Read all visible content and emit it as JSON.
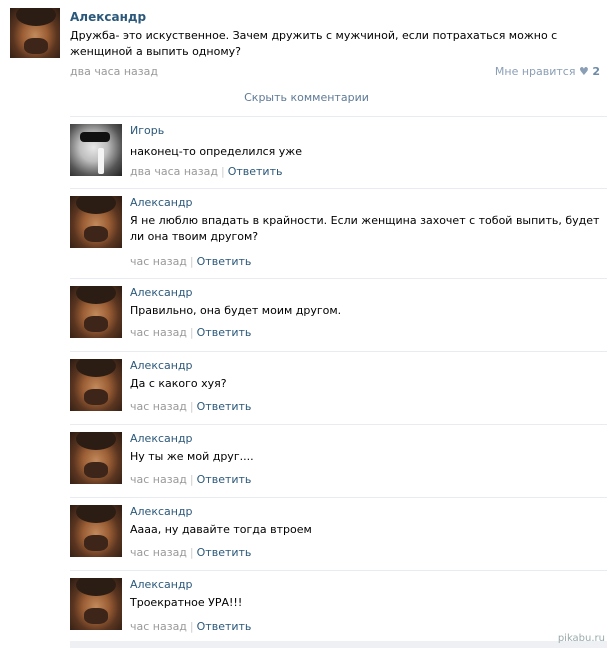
{
  "post": {
    "author": "Александр",
    "text": "Дружба- это искуственное. Зачем дружить с мужчиной, если потрахаться можно с женщиной а выпить одному?",
    "time": "два часа назад",
    "like_label": "Мне нравится",
    "like_count": "2"
  },
  "hide_comments": "Скрыть комментарии",
  "comments": [
    {
      "author": "Игорь",
      "text": "наконец-то определился уже",
      "time": "два часа назад",
      "reply": "Ответить"
    },
    {
      "author": "Александр",
      "text": "Я не люблю впадать в крайности. Если женщина захочет с тобой выпить, будет ли она твоим другом?",
      "time": "час назад",
      "reply": "Ответить"
    },
    {
      "author": "Александр",
      "text": "Правильно, она будет моим другом.",
      "time": "час назад",
      "reply": "Ответить"
    },
    {
      "author": "Александр",
      "text": "Да с какого хуя?",
      "time": "час назад",
      "reply": "Ответить"
    },
    {
      "author": "Александр",
      "text": "Ну ты же мой друг....",
      "time": "час назад",
      "reply": "Ответить"
    },
    {
      "author": "Александр",
      "text": "Аааа, ну давайте тогда втроем",
      "time": "час назад",
      "reply": "Ответить"
    },
    {
      "author": "Александр",
      "text": "Троекратное УРА!!!",
      "time": "час назад",
      "reply": "Ответить"
    }
  ],
  "watermark": "pikabu.ru"
}
